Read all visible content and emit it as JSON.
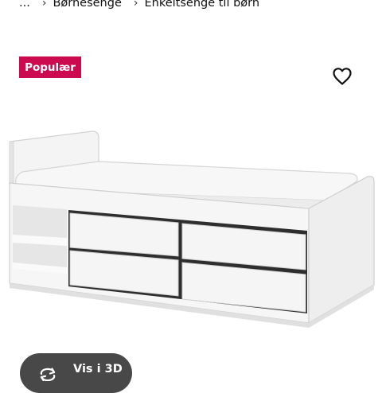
{
  "breadcrumb": {
    "ellipsis": "...",
    "items": [
      "Børnesenge",
      "Enkeltsenge til børn"
    ],
    "separator": "›"
  },
  "badge": {
    "label": "Populær",
    "color": "#cc0a4f"
  },
  "favorite": {
    "icon": "heart-outline-icon"
  },
  "product_image": {
    "description_icon": "bed-with-drawers-image"
  },
  "view3d": {
    "label": "Vis i 3D",
    "icon": "rotate-3d-icon"
  }
}
